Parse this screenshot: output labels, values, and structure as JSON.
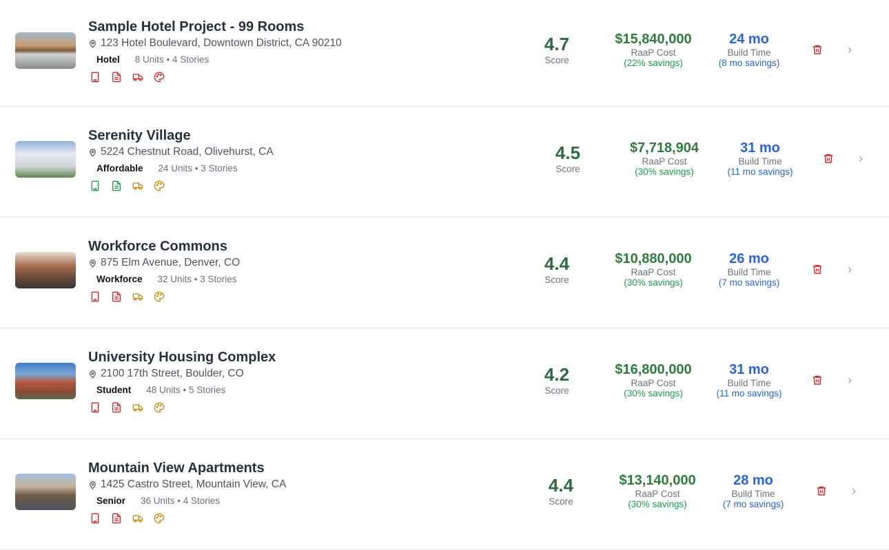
{
  "colors": {
    "red": "#dc2626",
    "green": "#16a34a",
    "amber": "#ca8a04"
  },
  "projects": [
    {
      "title": "Sample Hotel Project - 99 Rooms",
      "address": "123 Hotel Boulevard, Downtown District, CA 90210",
      "type": "Hotel",
      "units": "8 Units • 4 Stories",
      "score": "4.7",
      "score_label": "Score",
      "cost": "$15,840,000",
      "cost_label": "RaaP Cost",
      "cost_savings": "(22% savings)",
      "build_time": "24 mo",
      "build_label": "Build Time",
      "time_savings": "(8 mo savings)",
      "icon_colors": [
        "red",
        "red",
        "red",
        "red"
      ],
      "thumb": "linear-gradient(180deg,#9fb7d0 0%,#c9a070 35%,#7a5b3c 50%,#cfd1d1 60%,#8a8d8f 100%)"
    },
    {
      "title": "Serenity Village",
      "address": "5224 Chestnut Road, Olivehurst, CA",
      "type": "Affordable",
      "units": "24 Units • 3 Stories",
      "score": "4.5",
      "score_label": "Score",
      "cost": "$7,718,904",
      "cost_label": "RaaP Cost",
      "cost_savings": "(30% savings)",
      "build_time": "31 mo",
      "build_label": "Build Time",
      "time_savings": "(11 mo savings)",
      "icon_colors": [
        "green",
        "green",
        "amber",
        "amber"
      ],
      "thumb": "linear-gradient(180deg,#8fb2d8 0%,#e8eaee 35%,#cfd3d8 70%,#5d8a4a 100%)"
    },
    {
      "title": "Workforce Commons",
      "address": "875 Elm Avenue, Denver, CO",
      "type": "Workforce",
      "units": "32 Units • 3 Stories",
      "score": "4.4",
      "score_label": "Score",
      "cost": "$10,880,000",
      "cost_label": "RaaP Cost",
      "cost_savings": "(30% savings)",
      "build_time": "26 mo",
      "build_label": "Build Time",
      "time_savings": "(7 mo savings)",
      "icon_colors": [
        "red",
        "red",
        "amber",
        "amber"
      ],
      "thumb": "linear-gradient(180deg,#e8ddd2 0%,#a26c4c 40%,#6b4a3a 70%,#3a3430 100%)"
    },
    {
      "title": "University Housing Complex",
      "address": "2100 17th Street, Boulder, CO",
      "type": "Student",
      "units": "48 Units • 5 Stories",
      "score": "4.2",
      "score_label": "Score",
      "cost": "$16,800,000",
      "cost_label": "RaaP Cost",
      "cost_savings": "(30% savings)",
      "build_time": "31 mo",
      "build_label": "Build Time",
      "time_savings": "(11 mo savings)",
      "icon_colors": [
        "red",
        "red",
        "amber",
        "amber"
      ],
      "thumb": "linear-gradient(180deg,#3b7bc4 0%,#7aa7d8 30%,#b5573a 55%,#8a4a35 80%,#5a6a50 100%)"
    },
    {
      "title": "Mountain View Apartments",
      "address": "1425 Castro Street, Mountain View, CA",
      "type": "Senior",
      "units": "36 Units • 4 Stories",
      "score": "4.4",
      "score_label": "Score",
      "cost": "$13,140,000",
      "cost_label": "RaaP Cost",
      "cost_savings": "(30% savings)",
      "build_time": "28 mo",
      "build_label": "Build Time",
      "time_savings": "(7 mo savings)",
      "icon_colors": [
        "red",
        "red",
        "amber",
        "amber"
      ],
      "thumb": "linear-gradient(180deg,#9ec0e0 0%,#c7b59a 35%,#6e5a48 60%,#4a5560 100%)"
    }
  ]
}
